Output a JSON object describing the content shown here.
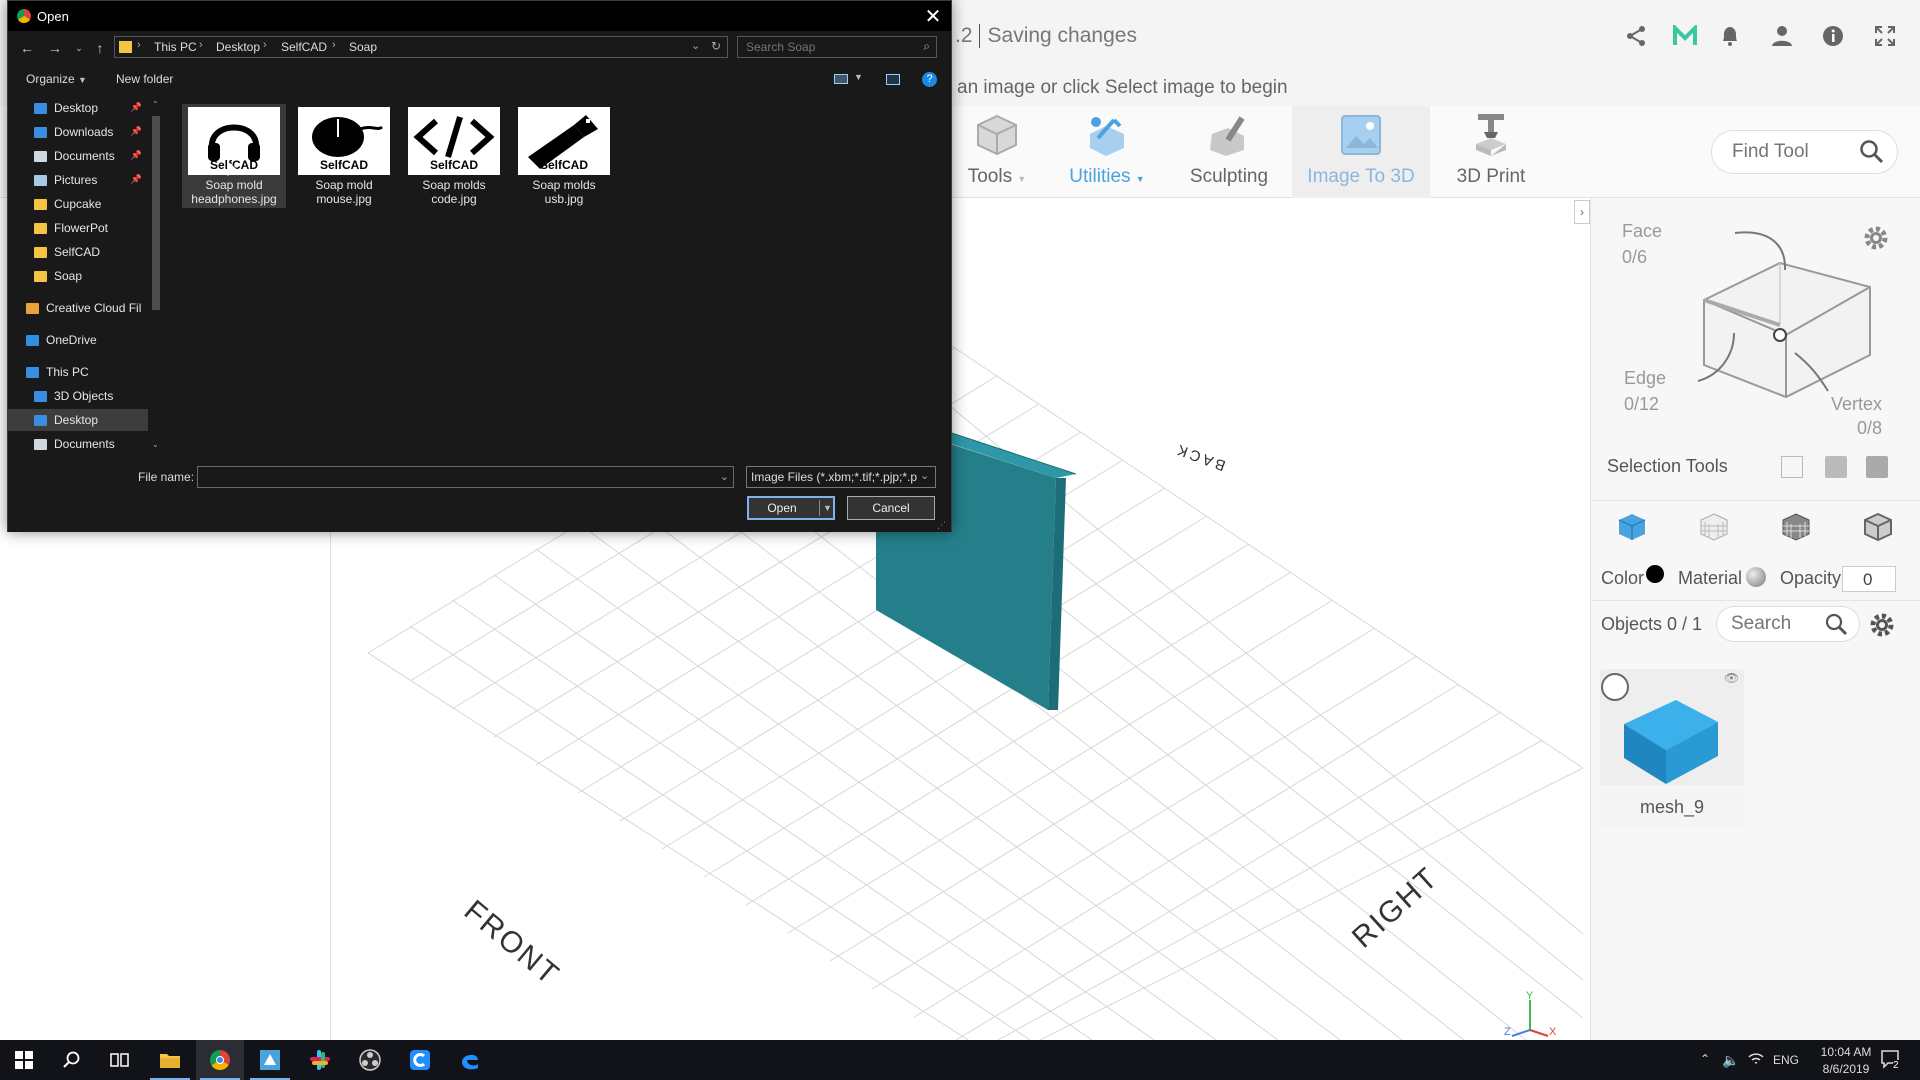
{
  "app": {
    "title_prefix": ".2",
    "status": "Saving changes",
    "hint": "an image or click Select image to begin",
    "find_tool_placeholder": "Find Tool",
    "tools": [
      {
        "label": "Tools",
        "icon": "cube-outline-icon"
      },
      {
        "label": "Utilities",
        "icon": "utilities-icon"
      },
      {
        "label": "Sculpting",
        "icon": "sculpting-icon"
      },
      {
        "label": "Image To 3D",
        "icon": "image-icon"
      },
      {
        "label": "3D Print",
        "icon": "printer-icon"
      }
    ],
    "viewport_labels": {
      "front": "FRONT",
      "right": "RIGHT",
      "back": "BACK"
    },
    "axis": {
      "y": "Y",
      "z": "Z",
      "x": "X"
    },
    "colors": {
      "accent": "#4aa3df",
      "object": "#2a8d9b",
      "active_tool": "#8cb6dc"
    }
  },
  "right_panel": {
    "face": "Face",
    "face_count": "0/6",
    "edge": "Edge",
    "edge_count": "0/12",
    "vertex": "Vertex",
    "vertex_count": "0/8",
    "selection_tools": "Selection Tools",
    "color_label": "Color",
    "material_label": "Material",
    "opacity_label": "Opacity",
    "opacity_value": "0",
    "objects_label": "Objects 0 / 1",
    "search_placeholder": "Search",
    "object_name": "mesh_9"
  },
  "dialog": {
    "title": "Open",
    "breadcrumb": [
      "This PC",
      "Desktop",
      "SelfCAD",
      "Soap"
    ],
    "search_placeholder": "Search Soap",
    "organize": "Organize",
    "new_folder": "New folder",
    "nav_items": [
      {
        "label": "Desktop",
        "color": "#3b8de0",
        "pinned": true
      },
      {
        "label": "Downloads",
        "color": "#3b8de0",
        "pinned": true
      },
      {
        "label": "Documents",
        "color": "#cfd8e0",
        "pinned": true
      },
      {
        "label": "Pictures",
        "color": "#a9c8e8",
        "pinned": true
      },
      {
        "label": "Cupcake",
        "color": "#f4c542",
        "pinned": false
      },
      {
        "label": "FlowerPot",
        "color": "#f4c542",
        "pinned": false
      },
      {
        "label": "SelfCAD",
        "color": "#f4c542",
        "pinned": false
      },
      {
        "label": "Soap",
        "color": "#f4c542",
        "pinned": false
      },
      {
        "label": "Creative Cloud Fil",
        "color": "#e8a33a",
        "pinned": false
      },
      {
        "label": "OneDrive",
        "color": "#2f8fe0",
        "pinned": false
      },
      {
        "label": "This PC",
        "color": "#3b8de0",
        "pinned": false
      },
      {
        "label": "3D Objects",
        "color": "#3b8de0",
        "pinned": false
      },
      {
        "label": "Desktop",
        "color": "#3b8de0",
        "pinned": false
      },
      {
        "label": "Documents",
        "color": "#cfd8e0",
        "pinned": false
      }
    ],
    "files": [
      {
        "name": "Soap mold headphones.jpg",
        "icon": "headphones-icon",
        "brand": "SelfCAD"
      },
      {
        "name": "Soap mold mouse.jpg",
        "icon": "mouse-icon",
        "brand": "SelfCAD"
      },
      {
        "name": "Soap molds code.jpg",
        "icon": "code-icon",
        "brand": "SelfCAD"
      },
      {
        "name": "Soap molds usb.jpg",
        "icon": "usb-icon",
        "brand": "SelfCAD"
      }
    ],
    "file_name_label": "File name:",
    "file_name_value": "",
    "file_type": "Image Files (*.xbm;*.tif;*.pjp;*.p",
    "open_btn": "Open",
    "cancel_btn": "Cancel"
  },
  "taskbar": {
    "lang": "ENG",
    "time": "10:04 AM",
    "date": "8/6/2019",
    "notification_count": "2"
  }
}
